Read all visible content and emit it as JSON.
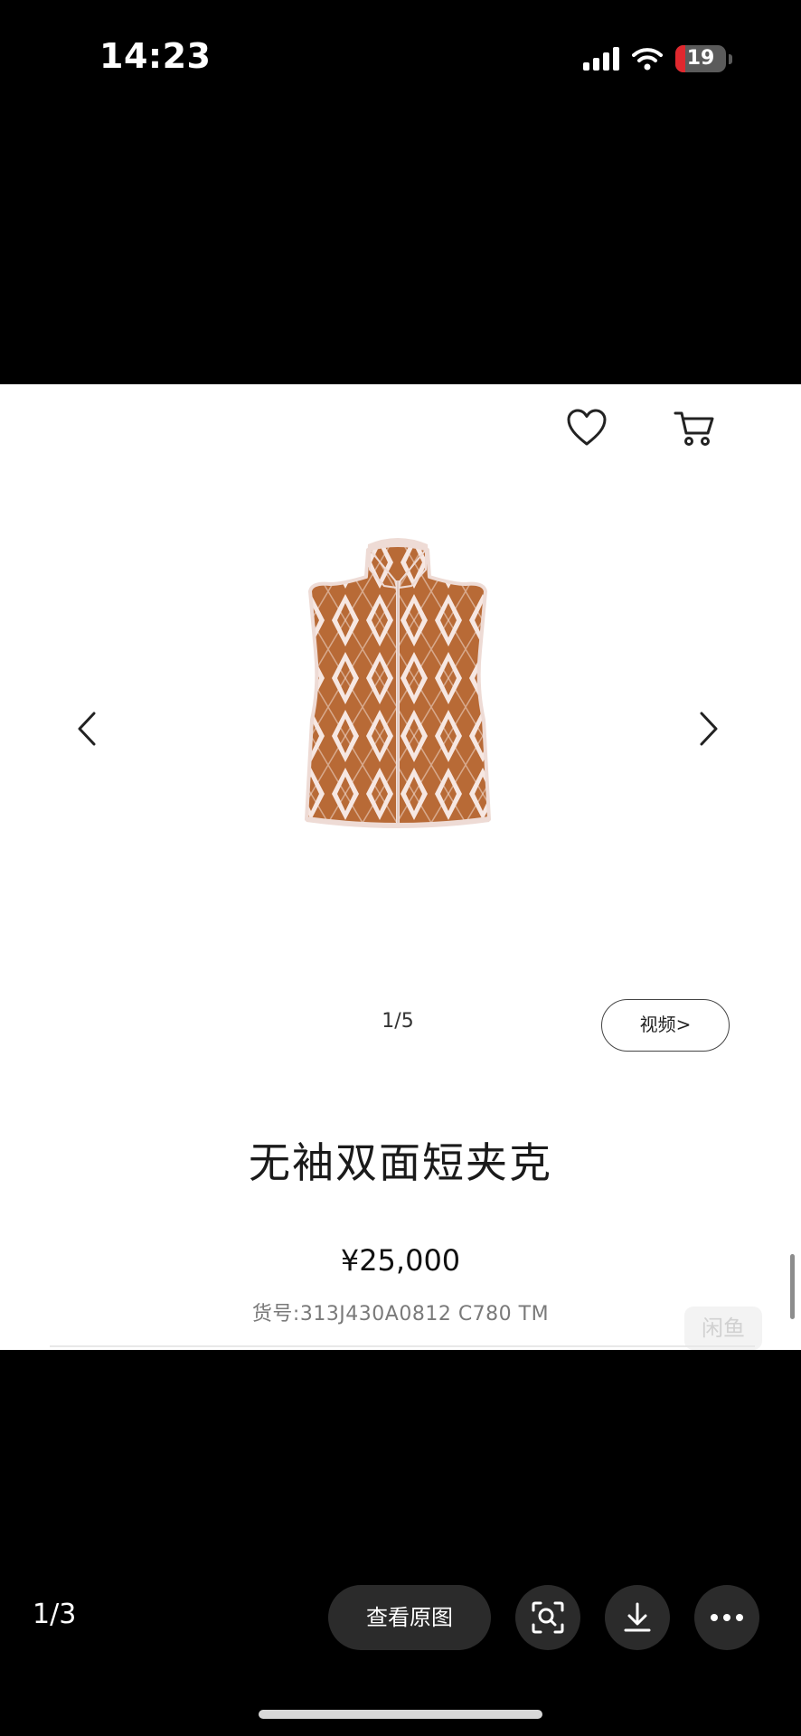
{
  "status_bar": {
    "time": "14:23",
    "battery_level": "19",
    "battery_fraction": 0.19,
    "icons": [
      "signal-icon",
      "wifi-icon",
      "battery-icon"
    ]
  },
  "screenshot": {
    "header_icons": [
      "heart-icon",
      "cart-icon"
    ],
    "nav_icons": [
      "chevron-left-icon",
      "chevron-right-icon"
    ],
    "pager": "1/5",
    "video_button_label": "视频>",
    "product_title": "无袖双面短夹克",
    "price": "¥25,000",
    "sku": "货号:313J430A0812 C780 TM",
    "watermark": "闲鱼",
    "colors": {
      "vest_main": "#b86a36",
      "vest_pattern": "#f6e7e2",
      "trim": "#eedbd5"
    }
  },
  "viewer": {
    "image_counter": "1/3",
    "view_original_label": "查看原图",
    "action_icons": [
      "scan-search-icon",
      "download-icon",
      "more-icon"
    ]
  }
}
